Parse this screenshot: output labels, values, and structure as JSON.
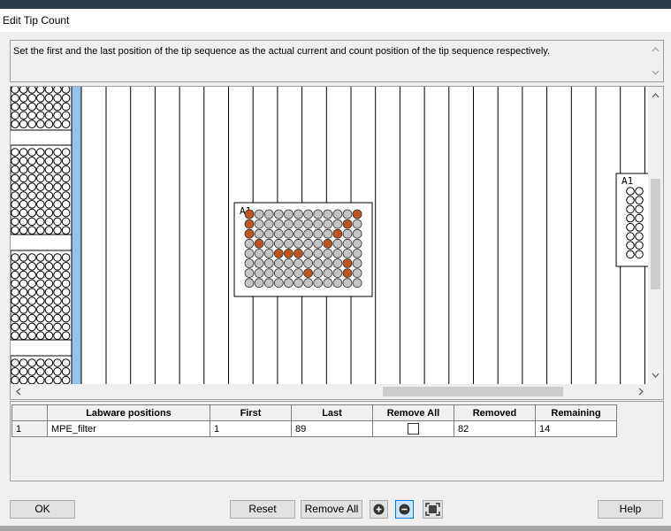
{
  "window": {
    "title": "Edit Tip Count"
  },
  "description": "Set the first and the last position of the tip sequence as the actual  current and count position of the tip sequence respectively.",
  "deck": {
    "labware_label": "A1",
    "edge_labware_label": "A1",
    "plate": {
      "rows": 8,
      "cols": 12
    },
    "highlighted_wells": [
      [
        0,
        0
      ],
      [
        0,
        11
      ],
      [
        1,
        0
      ],
      [
        1,
        10
      ],
      [
        2,
        0
      ],
      [
        2,
        9
      ],
      [
        3,
        1
      ],
      [
        3,
        8
      ],
      [
        4,
        3
      ],
      [
        4,
        4
      ],
      [
        4,
        5
      ],
      [
        5,
        10
      ],
      [
        6,
        6
      ],
      [
        6,
        10
      ]
    ],
    "colors": {
      "tip_highlight": "#c0561f",
      "tip_normal": "#c4c4c4",
      "carrier_blue": "#99c1ee"
    }
  },
  "grid": {
    "headers": [
      "",
      "Labware positions",
      "First",
      "Last",
      "Remove All",
      "Removed",
      "Remaining"
    ],
    "rows": [
      {
        "index": "1",
        "labware": "MPE_filter",
        "first": "1",
        "last": "89",
        "remove_all": false,
        "removed": "82",
        "remaining": "14"
      }
    ]
  },
  "buttons": {
    "ok": "OK",
    "reset": "Reset",
    "remove_all": "Remove All",
    "help": "Help",
    "zoom_in_icon": "zoom-in-icon",
    "zoom_out_icon": "zoom-out-icon",
    "fit_icon": "fit-to-window-icon"
  }
}
